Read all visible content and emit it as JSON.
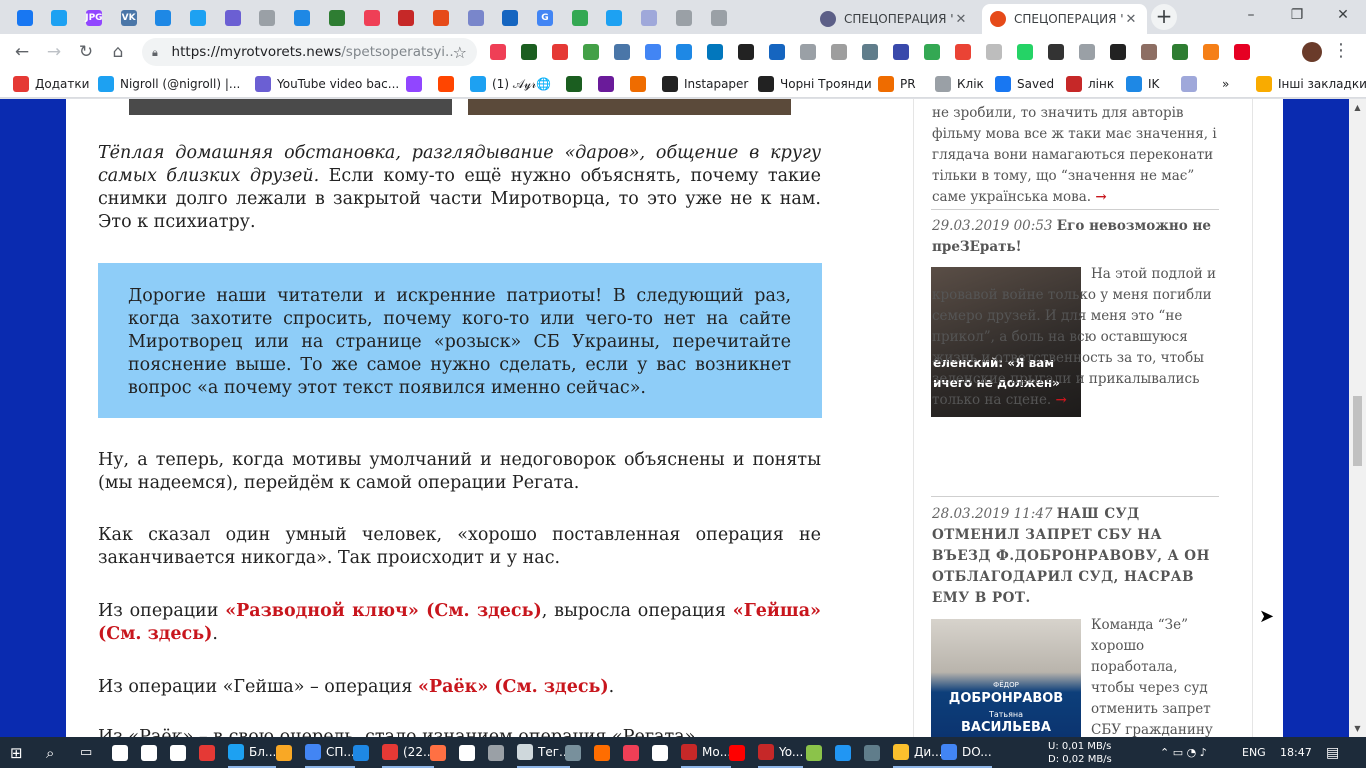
{
  "tabs": {
    "mini": [
      {
        "color": "#1877f2",
        "label": ""
      },
      {
        "color": "#1da1f2",
        "label": ""
      },
      {
        "color": "#9146ff",
        "label": "JPG"
      },
      {
        "color": "#4a76a8",
        "label": "VK"
      },
      {
        "color": "#1e88e5",
        "label": ""
      },
      {
        "color": "#1da1f2",
        "label": ""
      },
      {
        "color": "#6b5fd3",
        "label": ""
      },
      {
        "color": "#9aa0a6",
        "label": ""
      },
      {
        "color": "#1e88e5",
        "label": ""
      },
      {
        "color": "#2e7d32",
        "label": ""
      },
      {
        "color": "#ef3f56",
        "label": ""
      },
      {
        "color": "#c62828",
        "label": ""
      },
      {
        "color": "#e64a19",
        "label": ""
      },
      {
        "color": "#7986cb",
        "label": ""
      },
      {
        "color": "#1565c0",
        "label": ""
      },
      {
        "color": "#4285f4",
        "label": "G"
      },
      {
        "color": "#34a853",
        "label": ""
      },
      {
        "color": "#1da1f2",
        "label": ""
      },
      {
        "color": "#9fa8da",
        "label": ""
      },
      {
        "color": "#9aa0a6",
        "label": ""
      },
      {
        "color": "#9aa0a6",
        "label": ""
      }
    ],
    "full": [
      {
        "title": "СПЕЦОПЕРАЦИЯ \"",
        "active": false
      },
      {
        "title": "СПЕЦОПЕРАЦИЯ \"",
        "active": true
      }
    ],
    "new_tab_label": "+"
  },
  "window": {
    "minimize": "–",
    "maximize": "❐",
    "close": "✕"
  },
  "address": {
    "host": "https://myrotvorets.news",
    "path": "/spetsoperatsyi..."
  },
  "bookmarks": [
    {
      "label": "Додатки",
      "color": "#e53935"
    },
    {
      "label": "Nigroll (@nigroll) |...",
      "color": "#1da1f2"
    },
    {
      "label": "YouTube video bac...",
      "color": "#6b5fd3"
    },
    {
      "label": "",
      "color": "#9146ff"
    },
    {
      "label": "",
      "color": "#ff4500"
    },
    {
      "label": "(1) 𝒜𝓎𝓇🌐",
      "color": "#1da1f2"
    },
    {
      "label": "",
      "color": "#1b5e20"
    },
    {
      "label": "",
      "color": "#6a1b9a"
    },
    {
      "label": "",
      "color": "#ef6c00"
    },
    {
      "label": "Instapaper",
      "color": "#222222"
    },
    {
      "label": "Чорні Троянди",
      "color": "#222222"
    },
    {
      "label": "PR",
      "color": "#ef6c00"
    },
    {
      "label": "Клік",
      "color": "#9aa0a6"
    },
    {
      "label": "Saved",
      "color": "#1877f2"
    },
    {
      "label": "лінк",
      "color": "#c62828"
    },
    {
      "label": "IK",
      "color": "#1e88e5"
    },
    {
      "label": "",
      "color": "#9fa8da"
    },
    {
      "label": "»",
      "color": ""
    },
    {
      "label": "Інші закладки",
      "color": "#f9ab00"
    }
  ],
  "article": {
    "p1_em": "Тёплая домашняя обстановка, разглядывание «даров», общение в кругу самых близких друзей.",
    "p1_rest": " Если кому-то ещё нужно объяснять, почему такие снимки долго лежали в закрытой части Миротворца, то это уже не к нам. Это к психиатру.",
    "callout": "Дорогие наши читатели и искренние патриоты! В следующий раз, когда захотите спросить, почему кого-то или чего-то нет на сайте Миротворец или на странице «розыск» СБ Украины, перечитайте пояснение выше. То же самое нужно сделать, если у вас возникнет вопрос «а почему этот текст появился именно сейчас».",
    "p2": "Ну, а теперь, когда мотивы умолчаний и недоговорок объяснены и поняты (мы надеемся), перейдём к самой операции Регата.",
    "p3": "Как сказал один умный человек, «хорошо поставленная операция не заканчивается никогда». Так происходит и у нас.",
    "p4_a": "Из операции ",
    "p4_link1": "«Разводной ключ» (См. здесь)",
    "p4_b": ", выросла операция ",
    "p4_link2": "«Гейша» (См. здесь)",
    "p4_c": ".",
    "p5_a": "Из операции «Гейша» – операция ",
    "p5_link": "«Раёк» (См. здесь)",
    "p5_b": ".",
    "p6_partial": "Из «Раёк» – в свою очередь, стало изнанием операция «Регата»."
  },
  "sidebar": {
    "item0_text": "не зробили, то значить для авторів фільму мова все ж таки має значення, і глядача вони намагаються переконати тільки в тому, що “значення не має” саме українська мова.",
    "arrow": "→",
    "item1_date": "29.03.2019 00:53",
    "item1_title": "Его невозможно не преЗЕрать!",
    "item1_thumb_caption1": "еленский: «Я вам",
    "item1_thumb_caption2": "ичего не должен»",
    "item1_text": "На этой подлой и кровавой войне только у меня погибли семеро друзей. И для меня это “не прикол”, а боль на всю оставшуюся жизнь и ответственность за то, чтобы зеленские прыгали и прикалывались только на сцене.",
    "item2_date": "28.03.2019 11:47",
    "item2_title": "НАШ СУД ОТМЕНИЛ ЗАПРЕТ СБУ НА ВЪЕЗД Ф.ДОБРОНРАВОВУ, А ОН ОТБЛАГОДАРИЛ СУД, НАСРАВ ЕМУ В РОТ.",
    "item2_thumb_name1": "ФЁДОР",
    "item2_thumb_big1": "ДОБРОНРАВОВ",
    "item2_thumb_name2": "Татьяна",
    "item2_thumb_big2": "ВАСИЛЬЕВА",
    "item2_text": "Команда “Зе” хорошо поработала, чтобы через суд отменить запрет СБУ гражданину"
  },
  "taskbar": {
    "items": [
      {
        "label": "",
        "color": "#ffffff"
      },
      {
        "label": "",
        "color": "#ffffff"
      },
      {
        "label": "",
        "color": "#ffffff"
      },
      {
        "label": "",
        "color": "#e53935"
      },
      {
        "label": "Бл...",
        "color": "#1da1f2"
      },
      {
        "label": "",
        "color": "#f9a825"
      },
      {
        "label": "СП...",
        "color": "#4285f4"
      },
      {
        "label": "",
        "color": "#1e88e5"
      },
      {
        "label": "(22...",
        "color": "#e53935"
      },
      {
        "label": "",
        "color": "#ff7043"
      },
      {
        "label": "",
        "color": "#ffffff"
      },
      {
        "label": "",
        "color": "#9aa0a6"
      },
      {
        "label": "Тег...",
        "color": "#cfd8dc"
      },
      {
        "label": "",
        "color": "#78909c"
      },
      {
        "label": "",
        "color": "#ff6d00"
      },
      {
        "label": "",
        "color": "#ef3f56"
      },
      {
        "label": "",
        "color": "#ffffff"
      },
      {
        "label": "Мо...",
        "color": "#c62828"
      },
      {
        "label": "",
        "color": "#ff0000"
      },
      {
        "label": "Yo...",
        "color": "#c62828"
      },
      {
        "label": "",
        "color": "#8bc34a"
      },
      {
        "label": "",
        "color": "#2196f3"
      },
      {
        "label": "",
        "color": "#607d8b"
      },
      {
        "label": "Ди...",
        "color": "#fbc02d"
      },
      {
        "label": "DO...",
        "color": "#4285f4"
      }
    ],
    "net_up": "U:  0,01 MB/s",
    "net_down": "D:  0,02 MB/s",
    "lang": "ENG",
    "time": "18:47"
  }
}
